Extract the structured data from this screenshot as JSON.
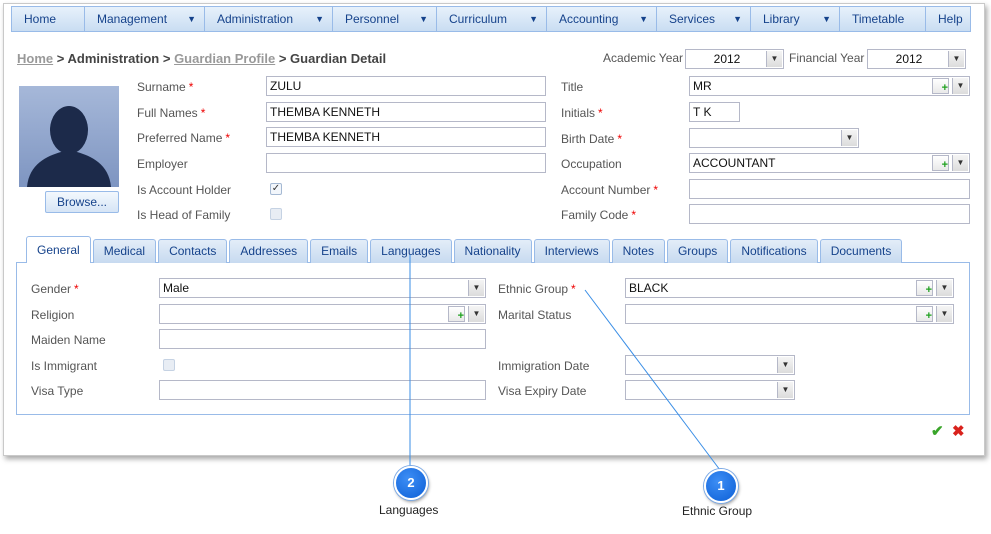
{
  "menu": [
    {
      "label": "Home",
      "dropdown": false
    },
    {
      "label": "Management",
      "dropdown": true
    },
    {
      "label": "Administration",
      "dropdown": true
    },
    {
      "label": "Personnel",
      "dropdown": true
    },
    {
      "label": "Curriculum",
      "dropdown": true
    },
    {
      "label": "Accounting",
      "dropdown": true
    },
    {
      "label": "Services",
      "dropdown": true
    },
    {
      "label": "Library",
      "dropdown": true
    },
    {
      "label": "Timetable",
      "dropdown": false
    },
    {
      "label": "Help",
      "dropdown": false
    }
  ],
  "breadcrumb": {
    "home": "Home",
    "sep": ">",
    "admin": "Administration",
    "profile": "Guardian Profile",
    "current": "Guardian Detail"
  },
  "years": {
    "academic_label": "Academic Year",
    "academic_value": "2012",
    "financial_label": "Financial Year",
    "financial_value": "2012"
  },
  "photo": {
    "browse_label": "Browse..."
  },
  "form": {
    "surname": {
      "label": "Surname",
      "value": "ZULU"
    },
    "full_names": {
      "label": "Full Names",
      "value": "THEMBA KENNETH"
    },
    "preferred_name": {
      "label": "Preferred Name",
      "value": "THEMBA KENNETH"
    },
    "employer": {
      "label": "Employer",
      "value": ""
    },
    "is_account_holder": {
      "label": "Is Account Holder",
      "checked": "✓"
    },
    "is_head_of_family": {
      "label": "Is Head of Family"
    },
    "title": {
      "label": "Title",
      "value": "MR"
    },
    "initials": {
      "label": "Initials",
      "value": "T K"
    },
    "birth_date": {
      "label": "Birth Date",
      "value": ""
    },
    "occupation": {
      "label": "Occupation",
      "value": "ACCOUNTANT"
    },
    "account_number": {
      "label": "Account Number",
      "value": ""
    },
    "family_code": {
      "label": "Family Code",
      "value": ""
    },
    "required_mark": "*"
  },
  "tabs": [
    "General",
    "Medical",
    "Contacts",
    "Addresses",
    "Emails",
    "Languages",
    "Nationality",
    "Interviews",
    "Notes",
    "Groups",
    "Notifications",
    "Documents"
  ],
  "general": {
    "gender": {
      "label": "Gender",
      "value": "Male"
    },
    "religion": {
      "label": "Religion",
      "value": ""
    },
    "maiden_name": {
      "label": "Maiden Name",
      "value": ""
    },
    "is_immigrant": {
      "label": "Is Immigrant"
    },
    "visa_type": {
      "label": "Visa Type",
      "value": ""
    },
    "ethnic_group": {
      "label": "Ethnic Group",
      "value": "BLACK"
    },
    "marital_status": {
      "label": "Marital Status",
      "value": ""
    },
    "immigration_date": {
      "label": "Immigration Date",
      "value": ""
    },
    "visa_expiry_date": {
      "label": "Visa Expiry Date",
      "value": ""
    }
  },
  "actions": {
    "save_icon": "✔",
    "cancel_icon": "✖"
  },
  "callouts": [
    {
      "number": "2",
      "label": "Languages"
    },
    {
      "number": "1",
      "label": "Ethnic Group"
    }
  ],
  "colors": {
    "accent": "#15428b",
    "border": "#99bbe8",
    "required": "#ee0000",
    "callout": "#1a6fe0"
  }
}
